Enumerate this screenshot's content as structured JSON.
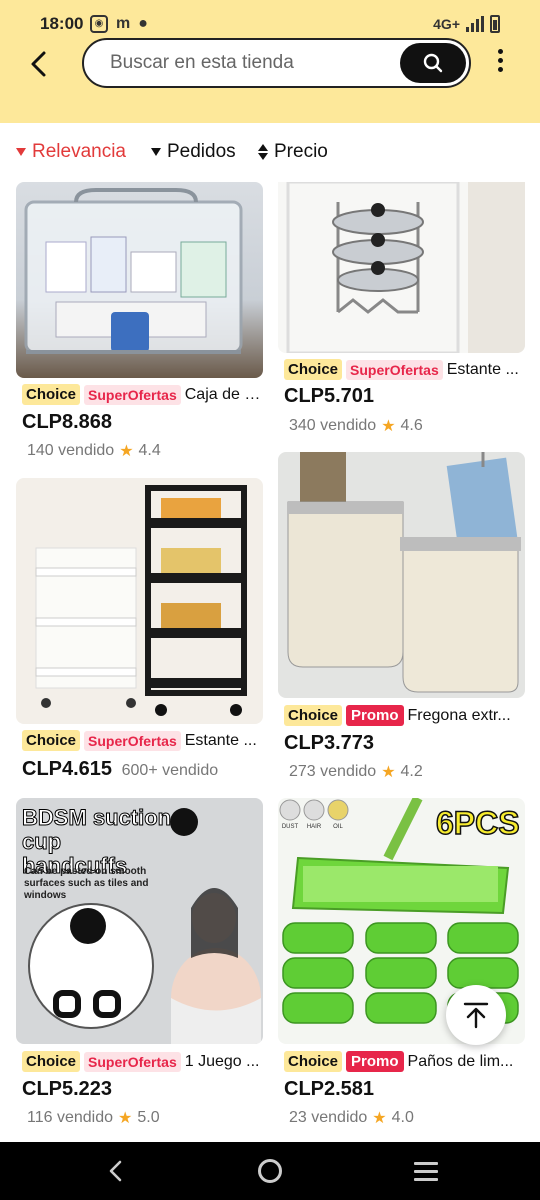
{
  "status": {
    "time": "18:00",
    "network": "4G+"
  },
  "search": {
    "placeholder": "Buscar en esta tienda"
  },
  "sort": {
    "relevance": "Relevancia",
    "orders": "Pedidos",
    "price": "Precio"
  },
  "tags": {
    "choice": "Choice",
    "super_prefix": "Super",
    "super_suffix": "Ofertas",
    "promo": "Promo"
  },
  "products": [
    {
      "title": "Caja de a...",
      "price": "CLP8.868",
      "sold": "140 vendido",
      "rating": "4.4",
      "badge": "super"
    },
    {
      "title": "Estante ...",
      "price": "CLP5.701",
      "sold": "340 vendido",
      "rating": "4.6",
      "badge": "super"
    },
    {
      "title": "Estante ...",
      "price": "CLP4.615",
      "sold": "600+ vendido",
      "rating": "",
      "badge": "super"
    },
    {
      "title": "Fregona extr...",
      "price": "CLP3.773",
      "sold": "273 vendido",
      "rating": "4.2",
      "badge": "promo"
    },
    {
      "title": "1 Juego ...",
      "price": "CLP5.223",
      "sold": "116 vendido",
      "rating": "5.0",
      "badge": "super"
    },
    {
      "title": "Paños de lim...",
      "price": "CLP2.581",
      "sold": "23 vendido",
      "rating": "4.0",
      "badge": "promo"
    }
  ],
  "images": {
    "handcuff_line1": "BDSM suction",
    "handcuff_line2": "cup handcuffs",
    "handcuff_sub": "Can be pasted on smooth surfaces such as tiles and windows",
    "pads_badge": "6PCS",
    "pads_icons": [
      "DUST",
      "HAIR",
      "OIL"
    ]
  },
  "colors": {
    "header_bg": "#fde89a",
    "accent_red": "#e23a3a",
    "promo_red": "#e7264a",
    "star": "#f5a623"
  }
}
